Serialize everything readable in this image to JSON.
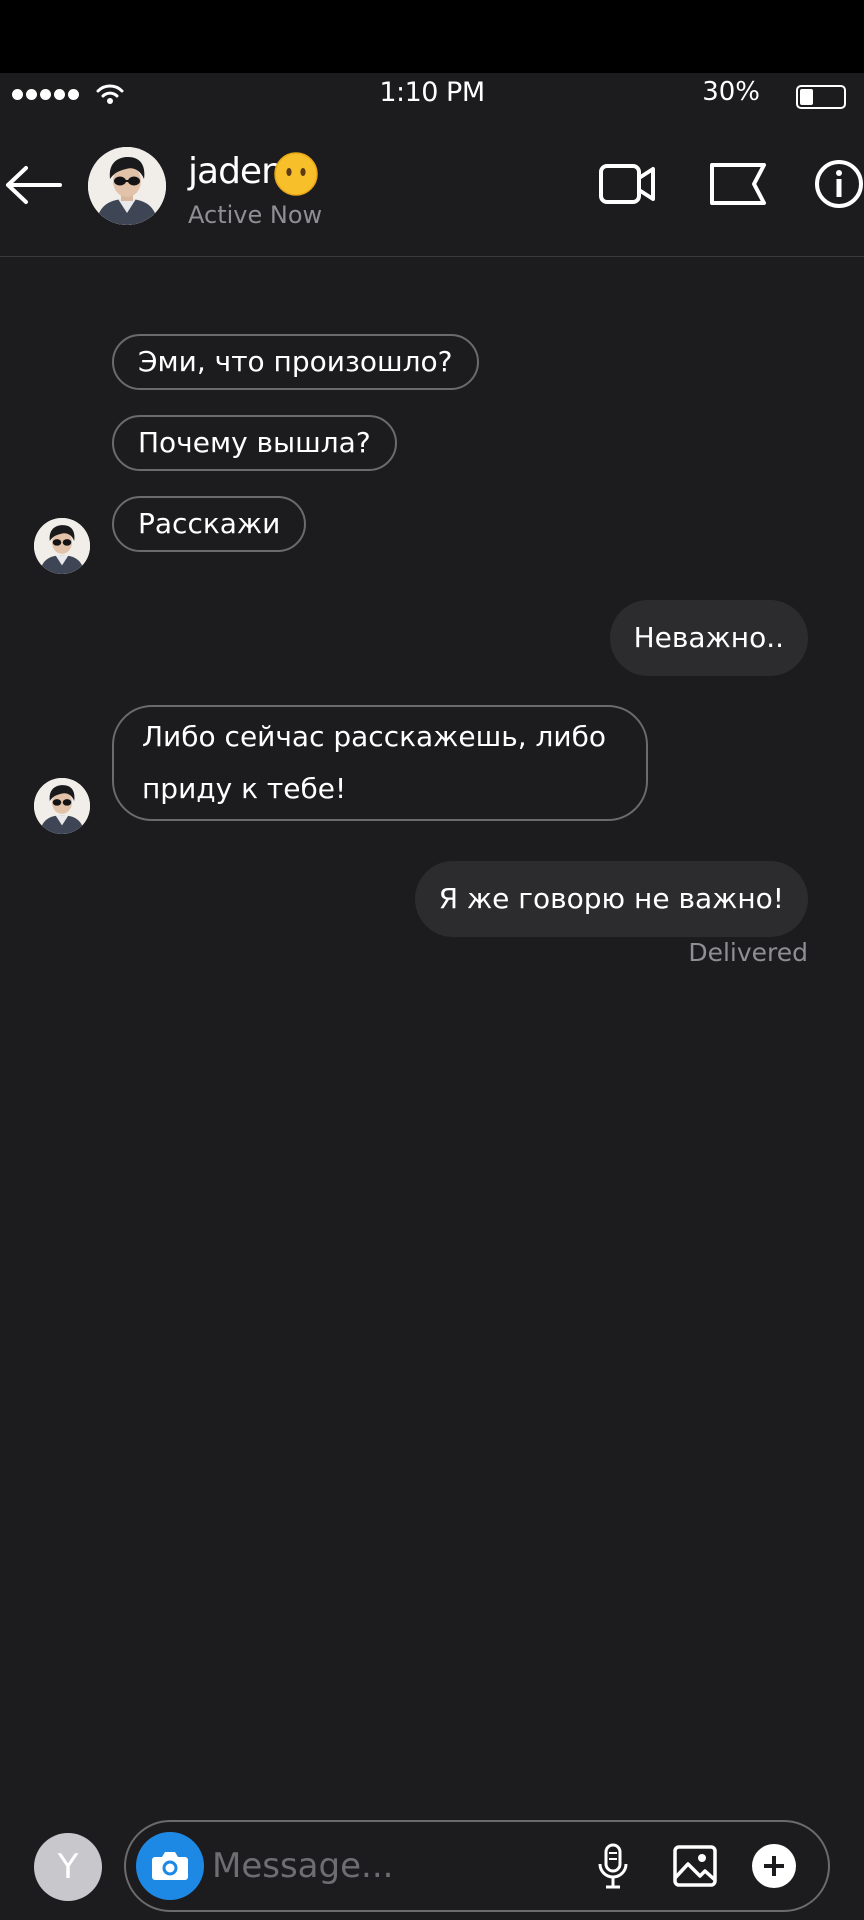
{
  "status_bar": {
    "time": "1:10 PM",
    "battery_percent": "30%",
    "battery_level": 0.3
  },
  "header": {
    "contact_name": "jaden",
    "contact_emoji_icon": "face-without-mouth-emoji",
    "status": "Active Now",
    "icons": [
      "back-arrow-icon",
      "video-camera-icon",
      "flag-icon",
      "info-icon"
    ]
  },
  "messages": [
    {
      "direction": "in",
      "text": "Эми, что произошло?"
    },
    {
      "direction": "in",
      "text": "Почему вышла?"
    },
    {
      "direction": "in",
      "text": "Расскажи"
    },
    {
      "direction": "out",
      "text": "Неважно.."
    },
    {
      "direction": "in",
      "text": "Либо сейчас расскажешь, либо приду к тебе!"
    },
    {
      "direction": "out",
      "text": "Я же говорю не важно!"
    }
  ],
  "delivery_status": "Delivered",
  "composer": {
    "user_initial": "Y",
    "placeholder": "Message...",
    "camera_color": "#1e88e5",
    "icons": [
      "camera-icon",
      "microphone-icon",
      "gallery-icon",
      "plus-icon"
    ]
  },
  "colors": {
    "background": "#1c1c1e",
    "outgoing_bubble": "#2c2c2e",
    "incoming_border": "#6b6b6e",
    "secondary_text": "#8e8e93"
  }
}
